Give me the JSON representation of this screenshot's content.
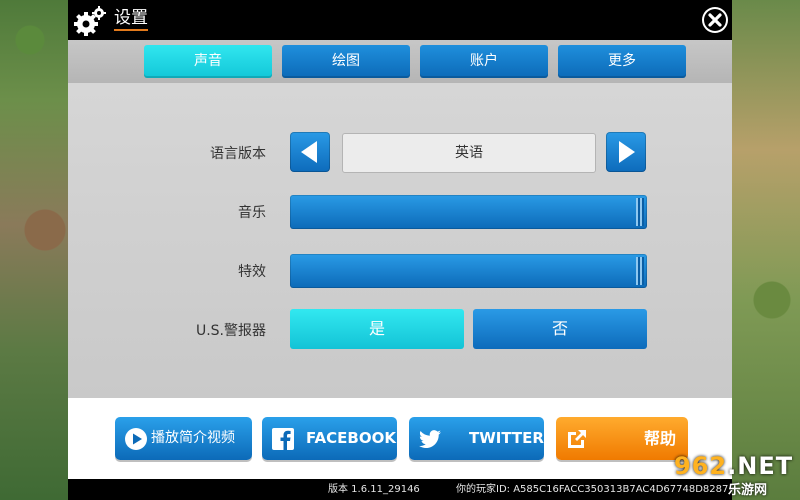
{
  "window": {
    "title": "设置",
    "close_icon": "close-icon"
  },
  "tabs": [
    {
      "label": "声音",
      "active": true
    },
    {
      "label": "绘图",
      "active": false
    },
    {
      "label": "账户",
      "active": false
    },
    {
      "label": "更多",
      "active": false
    }
  ],
  "settings": {
    "language": {
      "label": "语言版本",
      "value": "英语"
    },
    "music": {
      "label": "音乐",
      "level": 1.0
    },
    "effects": {
      "label": "特效",
      "level": 1.0
    },
    "alarm": {
      "label": "U.S.警报器",
      "yes": "是",
      "no": "否",
      "selected": "yes"
    }
  },
  "bottom_buttons": {
    "video": {
      "label": "播放简介视频",
      "icon": "play-icon"
    },
    "facebook": {
      "label": "FACEBOOK",
      "icon": "facebook-icon"
    },
    "twitter": {
      "label": "TWITTER",
      "icon": "twitter-icon"
    },
    "help": {
      "label": "帮助",
      "icon": "external-link-icon"
    }
  },
  "footer": {
    "version": "版本 1.6.11_29146",
    "player_id": "你的玩家ID: A585C16FACC350313B7AC4D67748D8287"
  },
  "watermark": {
    "brand": "962",
    "suffix": ".NET",
    "sub": "乐游网"
  },
  "colors": {
    "tab_active": "#12c7d8",
    "button_blue": "#0c6ab8",
    "button_orange": "#f07a00",
    "title_underline": "#e27a1c"
  }
}
